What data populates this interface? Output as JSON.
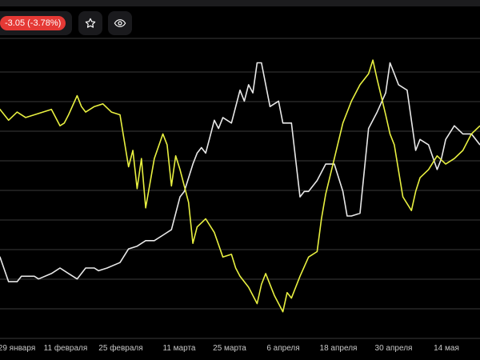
{
  "toolbar": {
    "change_label": "-3.05 (-3.78%)",
    "star_icon": "star-icon",
    "eye_icon": "eye-icon"
  },
  "colors": {
    "background": "#000000",
    "grid": "#3a3a3a",
    "series_white": "#e8e8e8",
    "series_yellow": "#e8f040",
    "badge_red": "#e53935"
  },
  "chart_data": {
    "type": "line",
    "title": "",
    "xlabel": "",
    "ylabel": "",
    "grid": true,
    "x_tick_labels": [
      "29 января",
      "11 февраля",
      "25 февраля",
      "11 марта",
      "25 марта",
      "6 апреля",
      "18 апреля",
      "30 апреля",
      "14 мая"
    ],
    "x_range": [
      0,
      112
    ],
    "y_range": [
      0,
      100
    ],
    "series": [
      {
        "color": "#e8e8e8",
        "x": [
          -4,
          0,
          2,
          4,
          5,
          8,
          9,
          12,
          14,
          16,
          18,
          20,
          22,
          23,
          25,
          28,
          30,
          32,
          34,
          36,
          38,
          40,
          42,
          43,
          45,
          46,
          47,
          48,
          49,
          50,
          51,
          52,
          54,
          56,
          57,
          58,
          59,
          60,
          61,
          63,
          65,
          66,
          68,
          70,
          71,
          72,
          74,
          76,
          78,
          80,
          81,
          82,
          84,
          86,
          88,
          90,
          91,
          92,
          93,
          95,
          97,
          98,
          100,
          102,
          103,
          104,
          106,
          108,
          110,
          112
        ],
        "y": [
          23,
          23,
          14,
          14,
          16,
          16,
          15,
          17,
          19,
          17,
          15,
          19,
          19,
          18,
          19,
          21,
          26,
          27,
          29,
          29,
          31,
          33,
          45,
          47,
          57,
          61,
          63,
          61,
          67,
          73,
          70,
          74,
          72,
          84,
          80,
          86,
          83,
          94,
          94,
          78,
          80,
          72,
          72,
          45,
          47,
          47,
          51,
          57,
          57,
          47,
          38,
          38,
          39,
          70,
          76,
          83,
          94,
          90,
          86,
          84,
          62,
          66,
          64,
          55,
          59,
          66,
          71,
          68,
          68,
          64
        ]
      },
      {
        "color": "#e8f040",
        "x": [
          -4,
          0,
          2,
          4,
          6,
          8,
          10,
          12,
          14,
          15,
          16,
          18,
          19,
          20,
          22,
          24,
          26,
          28,
          30,
          31,
          32,
          33,
          34,
          36,
          38,
          39,
          40,
          41,
          42,
          44,
          45,
          46,
          48,
          50,
          52,
          54,
          55,
          56,
          58,
          60,
          61,
          62,
          64,
          66,
          67,
          68,
          70,
          72,
          74,
          75,
          76,
          78,
          80,
          82,
          84,
          86,
          87,
          88,
          90,
          91,
          92,
          94,
          96,
          97,
          98,
          100,
          102,
          104,
          106,
          108,
          110,
          112
        ],
        "y": [
          77,
          77,
          73,
          76,
          74,
          75,
          76,
          77,
          71,
          72,
          75,
          82,
          78,
          76,
          78,
          79,
          76,
          75,
          56,
          62,
          48,
          59,
          41,
          59,
          68,
          64,
          49,
          60,
          55,
          43,
          28,
          34,
          37,
          32,
          23,
          24,
          19,
          16,
          12,
          6,
          13,
          17,
          9,
          3,
          10,
          8,
          16,
          23,
          25,
          37,
          46,
          59,
          72,
          80,
          86,
          90,
          95,
          88,
          75,
          68,
          64,
          45,
          40,
          47,
          52,
          55,
          60,
          57,
          59,
          62,
          68,
          71
        ]
      }
    ]
  }
}
